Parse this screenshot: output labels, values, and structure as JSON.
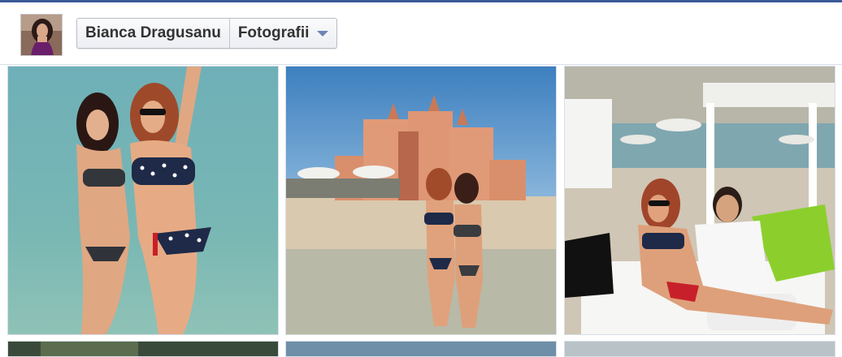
{
  "header": {
    "profile_name": "Bianca Dragusanu",
    "section": "Fotografii",
    "dropdown_icon": "chevron-down-icon",
    "accent_color": "#3b5998"
  },
  "photos": [
    {
      "subject": "two women in swimwear standing in sea water"
    },
    {
      "subject": "two women on beach in front of pink resort hotel"
    },
    {
      "subject": "woman and man on lounge bed at beach club"
    },
    {
      "subject": "photo thumbnail"
    },
    {
      "subject": "photo thumbnail"
    },
    {
      "subject": "photo thumbnail"
    }
  ]
}
